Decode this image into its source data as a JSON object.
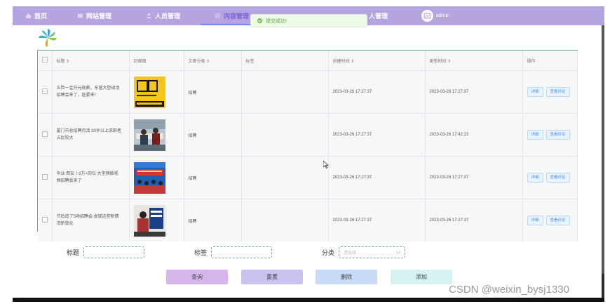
{
  "nav": {
    "items": [
      {
        "label": "首页",
        "active": false
      },
      {
        "label": "网站管理",
        "active": false
      },
      {
        "label": "人员管理",
        "active": false
      },
      {
        "label": "内容管理",
        "active": true
      },
      {
        "label": "人管理",
        "active": false
      }
    ],
    "user": "admin"
  },
  "toast": {
    "message": "提交成功!"
  },
  "table": {
    "headers": [
      "标题 ⇕",
      "封面图",
      "文章分类 ⇕",
      "标签",
      "创建时间 ⇕",
      "更新时间 ⇕",
      "操作"
    ],
    "rows": [
      {
        "title": "五险一金万元底薪，东营大型现场招聘会来了，赶紧来！",
        "category": "招聘",
        "tag": "",
        "created": "2023-03-26 17:27:37",
        "updated": "2023-03-26 17:27:37"
      },
      {
        "title": "厦门市总招聘月活 30岁以上求职者占比较大",
        "category": "招聘",
        "tag": "",
        "created": "2023-03-26 17:27:37",
        "updated": "2023-03-26 17:42:23"
      },
      {
        "title": "毕业 西安丨6万+岗位 大型网络视频招聘会来了",
        "category": "招聘",
        "tag": "",
        "created": "2023-03-26 17:27:37",
        "updated": "2023-03-26 17:27:37"
      },
      {
        "title": "节后逛了5场招聘会 发现这些新情况新变化",
        "category": "招聘",
        "tag": "",
        "created": "2023-03-26 17:27:37",
        "updated": "2023-03-26 17:27:37"
      }
    ],
    "detail_label": "详细",
    "comments_label": "查看评论"
  },
  "search": {
    "title_label": "标题",
    "tag_label": "标签",
    "category_label": "分类",
    "category_placeholder": "请选择"
  },
  "actions": {
    "query": "查询",
    "reset": "重置",
    "delete": "删除",
    "add": "添加"
  },
  "watermark": "CSDN @weixin_bysj1330",
  "colors": {
    "navbar": "#b6a4e0",
    "query_btn": "#d4b6ec",
    "reset_btn": "#c8c2ee",
    "delete_btn": "#c7daf6",
    "add_btn": "#d6f3f3"
  }
}
